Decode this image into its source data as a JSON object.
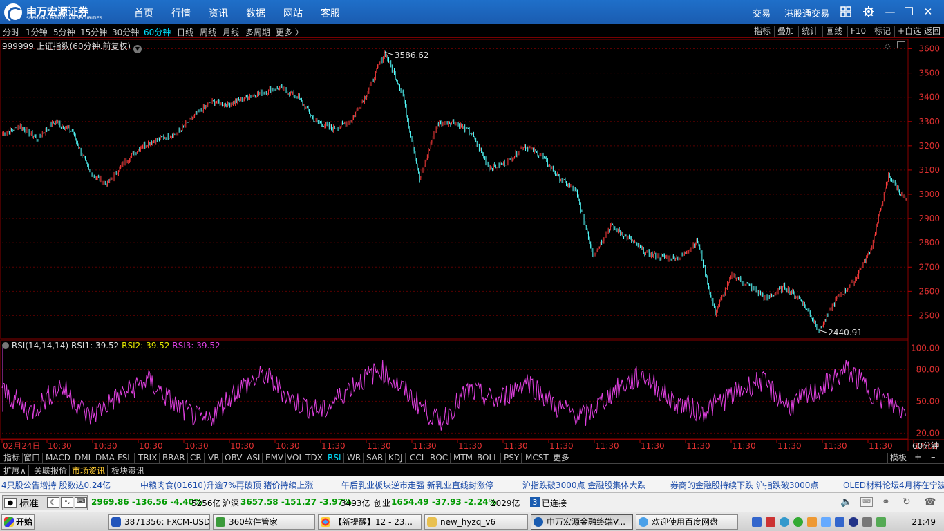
{
  "app": {
    "logo_name": "申万宏源证券",
    "logo_sub": "SHENWAN HONGYUAN SECURITIES",
    "nav": [
      "首页",
      "行情",
      "资讯",
      "数据",
      "网站",
      "客服"
    ],
    "right": [
      "交易",
      "港股通交易"
    ]
  },
  "periods": {
    "items": [
      "分时",
      "1分钟",
      "5分钟",
      "15分钟",
      "30分钟",
      "60分钟",
      "日线",
      "周线",
      "月线",
      "多周期",
      "更多 〉"
    ],
    "active": "60分钟"
  },
  "tools": [
    "指标",
    "叠加",
    "统计",
    "画线",
    "F10",
    "标记",
    "+自选",
    "返回"
  ],
  "chart_title": "999999 上证指数(60分钟.前复权)",
  "price_axis": {
    "labels": [
      "3600",
      "3500",
      "3400",
      "3300",
      "3200",
      "3100",
      "3000",
      "2900",
      "2800",
      "2700",
      "2600",
      "2500"
    ],
    "max_label": "3586.62",
    "min_label": "2440.91"
  },
  "rsi": {
    "name": "RSI(14,14,14)",
    "rsi1": "RSI1: 39.52",
    "rsi2": "RSI2: 39.52",
    "rsi3": "RSI3: 39.52",
    "axis_labels": [
      "100.00",
      "80.00",
      "50.00",
      "20.00"
    ],
    "colors": {
      "rsi1": "#e0e0e0",
      "rsi2": "#e8e800",
      "rsi3": "#e040e0"
    }
  },
  "time_axis": [
    "02月24日",
    "10:30",
    "10:30",
    "10:30",
    "10:30",
    "10:30",
    "10:30",
    "11:30",
    "11:30",
    "11:30",
    "11:30",
    "11:30",
    "11:30",
    "11:30",
    "11:30",
    "11:30",
    "11:30",
    "11:30",
    "11:30",
    "11:30",
    "14:00"
  ],
  "time_axis_unit": "60分钟",
  "chart_data": [
    {
      "type": "candlestick",
      "title": "999999 上证指数(60分钟.前复权)",
      "x_ticks": [
        "02月24日",
        "10:30",
        "10:30",
        "10:30",
        "10:30",
        "10:30",
        "10:30",
        "11:30",
        "11:30",
        "11:30",
        "11:30",
        "11:30",
        "11:30",
        "11:30",
        "11:30",
        "11:30",
        "11:30",
        "11:30",
        "11:30",
        "11:30",
        "14:00"
      ],
      "ylim": [
        2410,
        3630
      ],
      "y_ticks": [
        3600,
        3500,
        3400,
        3300,
        3200,
        3100,
        3000,
        2900,
        2800,
        2700,
        2600,
        2500
      ],
      "annotations": [
        {
          "label": "3586.62",
          "value": 3586.62
        },
        {
          "label": "2440.91",
          "value": 2440.91
        }
      ],
      "key_points": [
        3250,
        3280,
        3230,
        3300,
        3260,
        3090,
        3040,
        3130,
        3200,
        3230,
        3250,
        3320,
        3380,
        3370,
        3400,
        3420,
        3440,
        3400,
        3300,
        3270,
        3300,
        3420,
        3586.62,
        3420,
        3060,
        3290,
        3300,
        3250,
        3110,
        3130,
        3200,
        3160,
        3070,
        3010,
        2750,
        2870,
        2820,
        2760,
        2740,
        2740,
        2810,
        2510,
        2670,
        2620,
        2570,
        2620,
        2560,
        2440.91,
        2570,
        2640,
        2780,
        3080,
        2970
      ]
    },
    {
      "type": "line",
      "title": "RSI(14,14,14)",
      "ylim": [
        15,
        105
      ],
      "y_ticks": [
        100,
        80,
        50,
        20
      ],
      "series": [
        {
          "name": "RSI1",
          "last": 39.52
        },
        {
          "name": "RSI2",
          "last": 39.52
        },
        {
          "name": "RSI3",
          "last": 39.52,
          "key_points": [
            60,
            40,
            65,
            35,
            55,
            70,
            45,
            30,
            60,
            75,
            50,
            40,
            65,
            80,
            55,
            30,
            60,
            50,
            70,
            45,
            35,
            60,
            75,
            50,
            40,
            55,
            70,
            45,
            60,
            80,
            55,
            39.52
          ]
        }
      ]
    }
  ],
  "indicators": {
    "items": [
      "指标",
      "窗口",
      "MACD",
      "DMI",
      "DMA",
      "FSL",
      "TRIX",
      "BRAR",
      "CR",
      "VR",
      "OBV",
      "ASI",
      "EMV",
      "VOL-TDX",
      "RSI",
      "WR",
      "SAR",
      "KDJ",
      "CCI",
      "ROC",
      "MTM",
      "BOLL",
      "PSY",
      "MCST",
      "更多"
    ],
    "active": "RSI",
    "template": "模板"
  },
  "ext_tabs": {
    "items": [
      "扩展∧",
      "关联报价",
      "市场资讯",
      "板块资讯"
    ],
    "active": "市场资讯"
  },
  "news": [
    "4只股公告增持  股数达0.24亿",
    "中粮肉食(01610)升逾7%再破顶  猪价持续上涨",
    "午后乳业板块逆市走强  新乳业直线封涨停",
    "沪指跌破3000点  金融股集体大跌",
    "券商的金融股持续下跌  沪指跌破3000点",
    "OLED材料论坛4月将在宁波召"
  ],
  "status": {
    "mode": "标准",
    "sh": "2969.86 -136.56 -4.40%",
    "sh_vol": "5256亿",
    "sz_name": "沪深",
    "sz": "3657.58 -151.27 -3.97%",
    "sz_vol": "3493亿",
    "cy_name": "创业",
    "cy": "1654.49 -37.93 -2.24%",
    "cy_vol": "2029亿",
    "conn_num": "3",
    "conn": "已连接"
  },
  "taskbar": {
    "start": "开始",
    "tasks": [
      "3871356: FXCM-USD...",
      "360软件管家",
      "【新提醒】12 - 23...",
      "new_hyzq_v6",
      "申万宏源金融终端V...",
      "欢迎使用百度网盘"
    ],
    "clock": "21:49"
  }
}
